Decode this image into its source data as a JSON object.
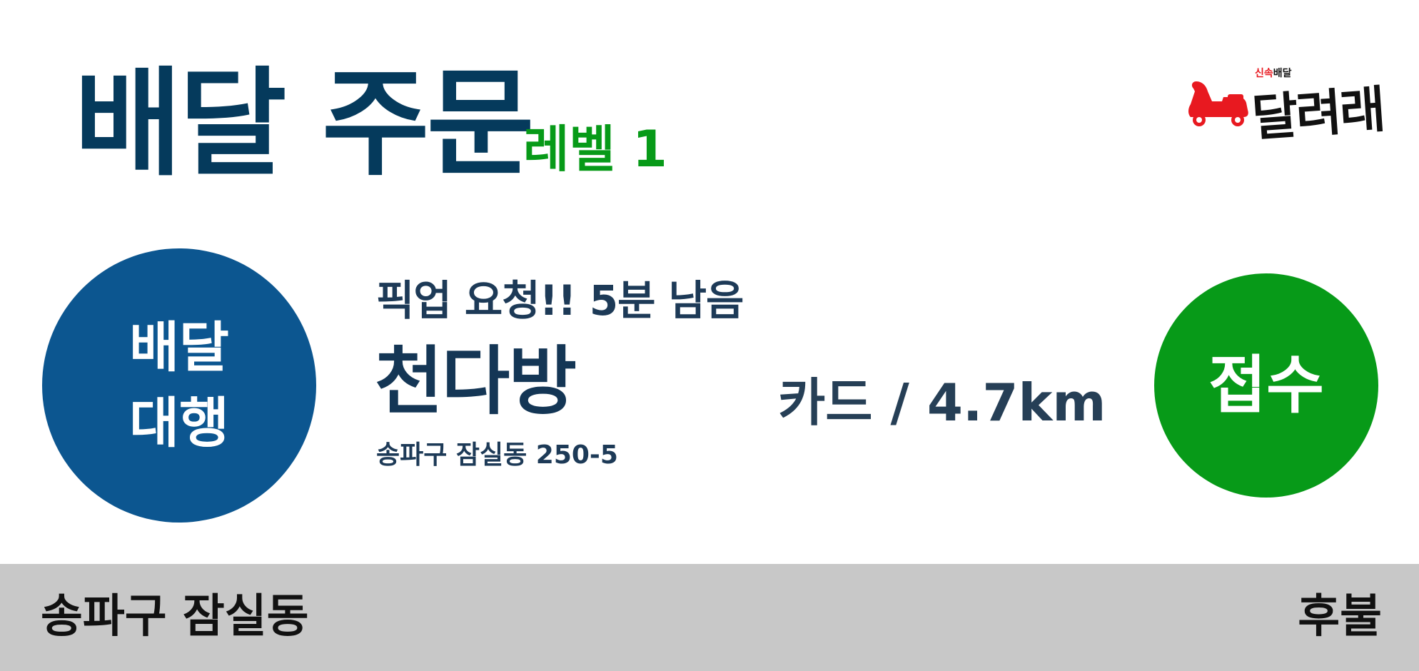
{
  "header": {
    "title": "배달 주문",
    "level": "레벨 1"
  },
  "logo": {
    "tagline_red": "신속",
    "tagline_black": "배달",
    "name": "달려래",
    "icon": "delivery-scooter-icon"
  },
  "order": {
    "service_type": "배달\n대행",
    "pickup_notice": "픽업 요청!! 5분 남음",
    "store_name": "천다방",
    "store_address": "송파구 잠실동 250-5",
    "payment_distance": "카드 / 4.7km",
    "accept_label": "접수"
  },
  "footer": {
    "delivery_area": "송파구 잠실동",
    "payment_timing": "후불"
  },
  "colors": {
    "title": "#053a5c",
    "level": "#079a18",
    "service_button": "#0c5690",
    "accept_button": "#079a18",
    "footer_bg": "#c8c8c8",
    "logo_red": "#e81920"
  }
}
